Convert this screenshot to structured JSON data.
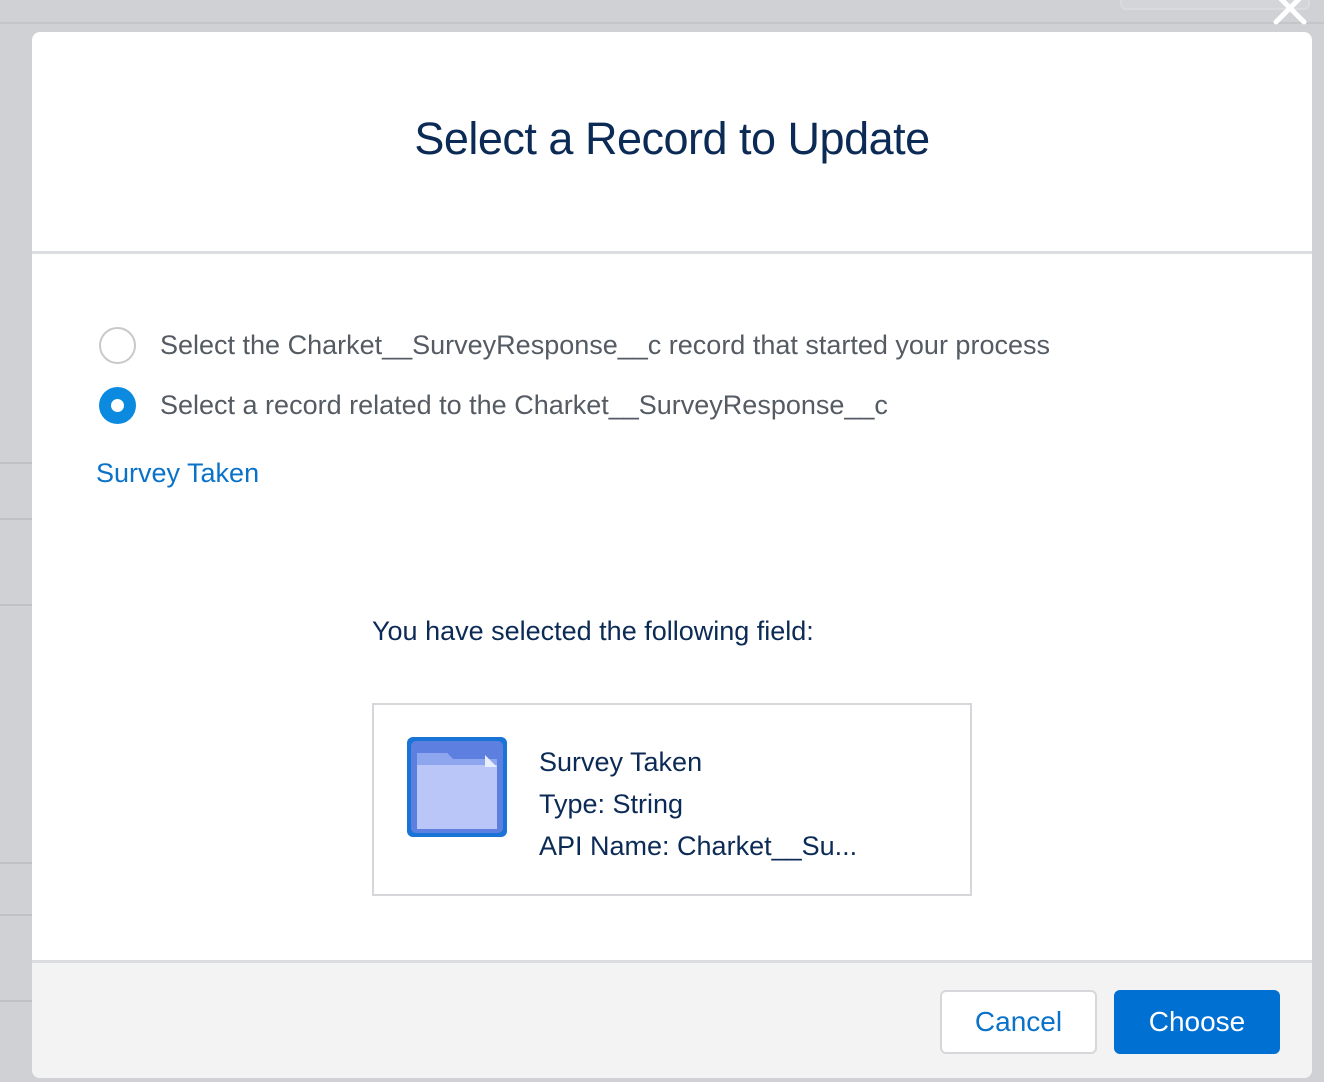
{
  "dialog": {
    "title": "Select a Record to Update",
    "close_icon": "close-icon"
  },
  "options": [
    {
      "label": "Select the Charket__SurveyResponse__c record that started your process",
      "checked": false
    },
    {
      "label": "Select a record related to the Charket__SurveyResponse__c",
      "checked": true
    }
  ],
  "related_link": "Survey Taken",
  "selection": {
    "heading": "You have selected the following field:",
    "icon": "folder-icon",
    "name": "Survey Taken",
    "type": "Type: String",
    "api_name": "API Name: Charket__Su..."
  },
  "footer": {
    "cancel_label": "Cancel",
    "choose_label": "Choose"
  },
  "colors": {
    "primary": "#0070d2",
    "title_text": "#0b2a55",
    "link": "#0a72c9"
  }
}
